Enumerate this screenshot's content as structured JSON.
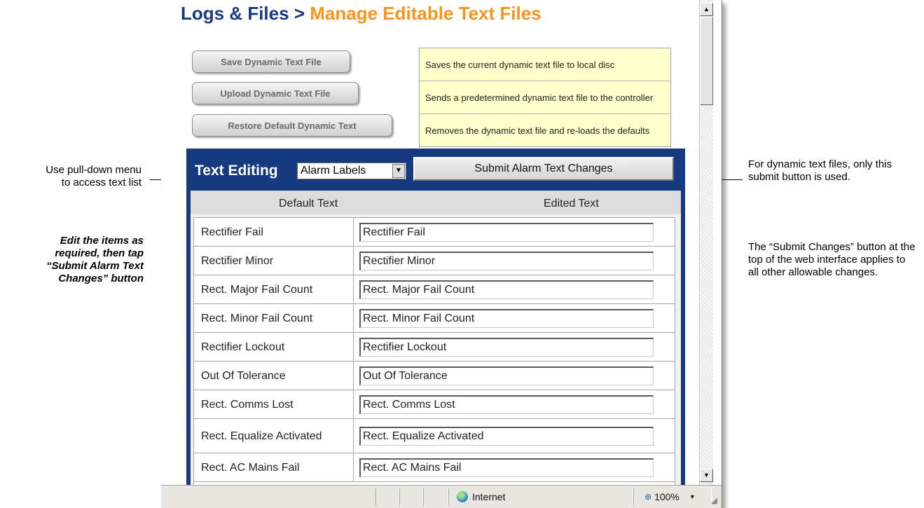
{
  "annotations": {
    "left_menu_note": "Use pull-down menu to access text list",
    "left_edit_note": "Edit the items as required, then tap “Submit Alarm Text Changes” button",
    "right_submit_note": "For dynamic text files, only this submit button is used.",
    "right_general_note": "The “Submit Changes” button at the top of the web interface applies to all other allowable changes."
  },
  "page": {
    "breadcrumb_root": "Logs & Files",
    "breadcrumb_sep": ">",
    "title": "Manage Editable Text Files"
  },
  "actions": [
    {
      "label": "Save Dynamic Text File",
      "tip": "Saves the current dynamic text file to local disc"
    },
    {
      "label": "Upload Dynamic Text File",
      "tip": "Sends a predetermined dynamic text file to the controller"
    },
    {
      "label": "Restore Default Dynamic Text",
      "tip": "Removes the dynamic text file and re-loads the defaults"
    }
  ],
  "editor": {
    "label": "Text Editing",
    "list_selected": "Alarm Labels",
    "submit_label": "Submit Alarm Text Changes",
    "col_default": "Default Text",
    "col_edited": "Edited Text",
    "rows": [
      {
        "default": "Rectifier Fail",
        "edited": "Rectifier Fail"
      },
      {
        "default": "Rectifier Minor",
        "edited": "Rectifier Minor"
      },
      {
        "default": "Rect. Major Fail Count",
        "edited": "Rect. Major Fail Count"
      },
      {
        "default": "Rect. Minor Fail Count",
        "edited": "Rect. Minor Fail Count"
      },
      {
        "default": "Rectifier Lockout",
        "edited": "Rectifier Lockout"
      },
      {
        "default": "Out Of Tolerance",
        "edited": "Out Of Tolerance"
      },
      {
        "default": "Rect. Comms Lost",
        "edited": "Rect. Comms Lost"
      },
      {
        "default": "Rect. Equalize Activated",
        "edited": "Rect. Equalize Activated"
      },
      {
        "default": "Rect. AC Mains Fail",
        "edited": "Rect. AC Mains Fail"
      }
    ]
  },
  "statusbar": {
    "zone": "Internet",
    "zoom": "100%"
  },
  "colors": {
    "nav_blue": "#163a82",
    "title_orange": "#f7941d",
    "tip_yellow": "#ffffcc"
  }
}
